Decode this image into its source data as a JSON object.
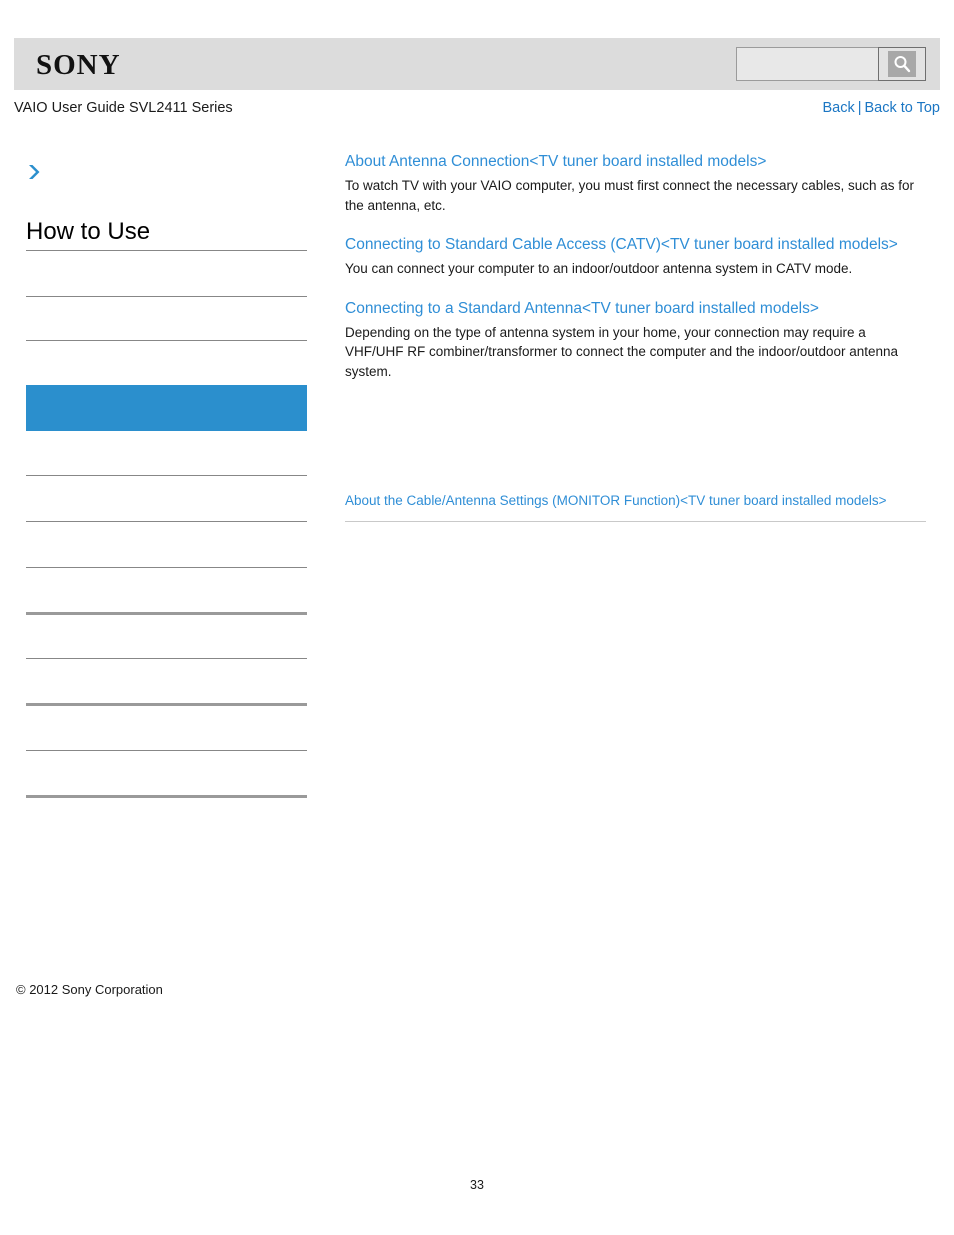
{
  "header": {
    "logo_text": "SONY",
    "search": {
      "value": "",
      "placeholder": "",
      "button_icon": "search-icon"
    }
  },
  "subheader": {
    "guide_title": "VAIO User Guide SVL2411 Series",
    "back_label": "Back",
    "separator": "|",
    "back_to_top_label": "Back to Top"
  },
  "sidebar": {
    "arrow_icon": "chevron-right-icon",
    "heading": "How to Use",
    "active_item_label": "",
    "items": [
      {
        "label": ""
      },
      {
        "label": ""
      },
      {
        "label": ""
      },
      {
        "label": ""
      },
      {
        "label": ""
      },
      {
        "label": ""
      },
      {
        "label": ""
      },
      {
        "label": ""
      },
      {
        "label": ""
      },
      {
        "label": ""
      },
      {
        "label": ""
      }
    ],
    "copyright": "© 2012 Sony Corporation"
  },
  "main": {
    "entries": [
      {
        "link": "About Antenna Connection<TV tuner board installed models>",
        "description": "To watch TV with your VAIO computer, you must first connect the necessary cables, such as for the antenna, etc."
      },
      {
        "link": "Connecting to Standard Cable Access (CATV)<TV tuner board installed models>",
        "description": "You can connect your computer to an indoor/outdoor antenna system in CATV mode."
      },
      {
        "link": "Connecting to a Standard Antenna<TV tuner board installed models>",
        "description": "Depending on the type of antenna system in your home, your connection may require a VHF/UHF RF combiner/transformer to connect the computer and the indoor/outdoor antenna system."
      }
    ],
    "standalone_link": "About the Cable/Antenna Settings (MONITOR Function)<TV tuner board installed models>"
  },
  "footer": {
    "page_number": "33"
  },
  "colors": {
    "link_blue": "#2f8ed6",
    "nav_blue": "#1b76c3",
    "active_highlight": "#2b8fcd",
    "header_band": "#dcdcdc",
    "separator_gray": "#878787"
  }
}
